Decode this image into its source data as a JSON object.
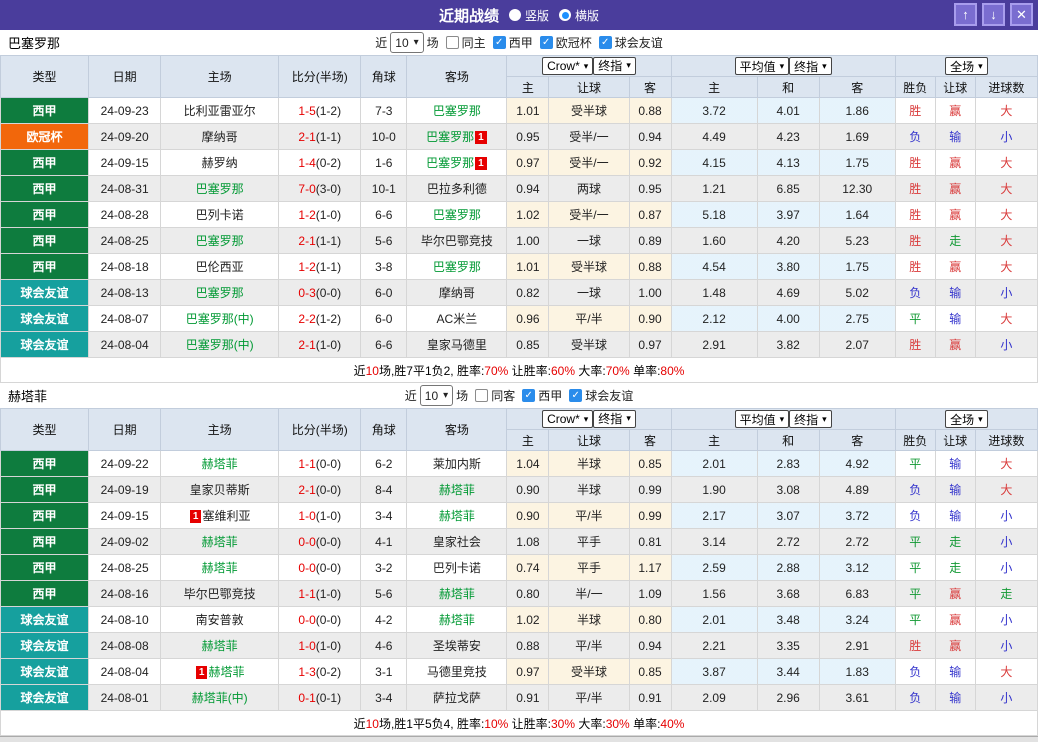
{
  "title_bar": {
    "title": "近期战绩",
    "modes": [
      {
        "label": "竖版",
        "selected": false
      },
      {
        "label": "横版",
        "selected": true
      }
    ]
  },
  "icons": {
    "arrow_up": "↑",
    "arrow_down": "↓",
    "close": "✕",
    "chevron_down": "▾",
    "check": "✓"
  },
  "colors": {
    "titlebar": "#4a3d9c",
    "type": {
      "西甲": "#0e7c3e",
      "欧冠杯": "#f2670b",
      "球会友谊": "#16a09e"
    },
    "team_green": "#009933",
    "score_red": "#e60000",
    "badge_red": "#e60000",
    "checkbox_blue": "#2a8ceb",
    "radio_selected": "#1e90ff",
    "result": {
      "胜": "#d93a3a",
      "赢": "#d93a3a",
      "大": "#d93a3a",
      "平": "#119933",
      "走": "#119933",
      "负": "#3333cc",
      "输": "#3333cc",
      "小": "#3333cc"
    }
  },
  "header": {
    "type": "类型",
    "date": "日期",
    "home": "主场",
    "score": "比分(半场)",
    "corner": "角球",
    "away": "客场",
    "crow": "Crow*",
    "final1": "终指",
    "avg": "平均值",
    "final2": "终指",
    "fulltime": "全场",
    "sub": [
      "主",
      "让球",
      "客",
      "主",
      "和",
      "客",
      "胜负",
      "让球",
      "进球数"
    ]
  },
  "teams": [
    {
      "name": "巴塞罗那",
      "filter": {
        "prefix": "近",
        "count": "10",
        "suffix": "场",
        "same": {
          "label": "同主",
          "checked": false
        },
        "leagues": [
          {
            "label": "西甲",
            "checked": true
          },
          {
            "label": "欧冠杯",
            "checked": true
          },
          {
            "label": "球会友谊",
            "checked": true
          }
        ]
      },
      "rows": [
        {
          "type": "西甲",
          "date": "24-09-23",
          "home": "比利亚雷亚尔",
          "home_green": false,
          "score": "1-5",
          "half": "(1-2)",
          "corner": "7-3",
          "away": "巴塞罗那",
          "away_green": true,
          "odds": [
            "1.01",
            "受半球",
            "0.88"
          ],
          "avg": [
            "3.72",
            "4.01",
            "1.86"
          ],
          "results": [
            "胜",
            "赢",
            "大"
          ]
        },
        {
          "type": "欧冠杯",
          "date": "24-09-20",
          "home": "摩纳哥",
          "home_green": false,
          "score": "2-1",
          "half": "(1-1)",
          "corner": "10-0",
          "away": "巴塞罗那",
          "away_green": true,
          "away_badge": "1",
          "odds": [
            "0.95",
            "受半/一",
            "0.94"
          ],
          "avg": [
            "4.49",
            "4.23",
            "1.69"
          ],
          "results": [
            "负",
            "输",
            "小"
          ]
        },
        {
          "type": "西甲",
          "date": "24-09-15",
          "home": "赫罗纳",
          "home_green": false,
          "score": "1-4",
          "half": "(0-2)",
          "corner": "1-6",
          "away": "巴塞罗那",
          "away_green": true,
          "away_badge": "1",
          "odds": [
            "0.97",
            "受半/一",
            "0.92"
          ],
          "avg": [
            "4.15",
            "4.13",
            "1.75"
          ],
          "results": [
            "胜",
            "赢",
            "大"
          ]
        },
        {
          "type": "西甲",
          "date": "24-08-31",
          "home": "巴塞罗那",
          "home_green": true,
          "score": "7-0",
          "half": "(3-0)",
          "corner": "10-1",
          "away": "巴拉多利德",
          "away_green": false,
          "odds": [
            "0.94",
            "两球",
            "0.95"
          ],
          "avg": [
            "1.21",
            "6.85",
            "12.30"
          ],
          "results": [
            "胜",
            "赢",
            "大"
          ]
        },
        {
          "type": "西甲",
          "date": "24-08-28",
          "home": "巴列卡诺",
          "home_green": false,
          "score": "1-2",
          "half": "(1-0)",
          "corner": "6-6",
          "away": "巴塞罗那",
          "away_green": true,
          "odds": [
            "1.02",
            "受半/一",
            "0.87"
          ],
          "avg": [
            "5.18",
            "3.97",
            "1.64"
          ],
          "results": [
            "胜",
            "赢",
            "大"
          ]
        },
        {
          "type": "西甲",
          "date": "24-08-25",
          "home": "巴塞罗那",
          "home_green": true,
          "score": "2-1",
          "half": "(1-1)",
          "corner": "5-6",
          "away": "毕尔巴鄂竞技",
          "away_green": false,
          "odds": [
            "1.00",
            "一球",
            "0.89"
          ],
          "avg": [
            "1.60",
            "4.20",
            "5.23"
          ],
          "results": [
            "胜",
            "走",
            "大"
          ]
        },
        {
          "type": "西甲",
          "date": "24-08-18",
          "home": "巴伦西亚",
          "home_green": false,
          "score": "1-2",
          "half": "(1-1)",
          "corner": "3-8",
          "away": "巴塞罗那",
          "away_green": true,
          "odds": [
            "1.01",
            "受半球",
            "0.88"
          ],
          "avg": [
            "4.54",
            "3.80",
            "1.75"
          ],
          "results": [
            "胜",
            "赢",
            "大"
          ]
        },
        {
          "type": "球会友谊",
          "date": "24-08-13",
          "home": "巴塞罗那",
          "home_green": true,
          "score": "0-3",
          "half": "(0-0)",
          "corner": "6-0",
          "away": "摩纳哥",
          "away_green": false,
          "odds": [
            "0.82",
            "一球",
            "1.00"
          ],
          "avg": [
            "1.48",
            "4.69",
            "5.02"
          ],
          "results": [
            "负",
            "输",
            "小"
          ]
        },
        {
          "type": "球会友谊",
          "date": "24-08-07",
          "home": "巴塞罗那(中)",
          "home_green": true,
          "score": "2-2",
          "half": "(1-2)",
          "corner": "6-0",
          "away": "AC米兰",
          "away_green": false,
          "odds": [
            "0.96",
            "平/半",
            "0.90"
          ],
          "avg": [
            "2.12",
            "4.00",
            "2.75"
          ],
          "results": [
            "平",
            "输",
            "大"
          ]
        },
        {
          "type": "球会友谊",
          "date": "24-08-04",
          "home": "巴塞罗那(中)",
          "home_green": true,
          "score": "2-1",
          "half": "(1-0)",
          "corner": "6-6",
          "away": "皇家马德里",
          "away_green": false,
          "odds": [
            "0.85",
            "受半球",
            "0.97"
          ],
          "avg": [
            "2.91",
            "3.82",
            "2.07"
          ],
          "results": [
            "胜",
            "赢",
            "小"
          ]
        }
      ],
      "summary_parts": [
        {
          "text": "近"
        },
        {
          "text": "10",
          "red": true
        },
        {
          "text": "场,胜7平1负2, 胜率:"
        },
        {
          "text": "70%",
          "red": true
        },
        {
          "text": " 让胜率:"
        },
        {
          "text": "60%",
          "red": true
        },
        {
          "text": " 大率:"
        },
        {
          "text": "70%",
          "red": true
        },
        {
          "text": " 单率:"
        },
        {
          "text": "80%",
          "red": true
        }
      ]
    },
    {
      "name": "赫塔菲",
      "filter": {
        "prefix": "近",
        "count": "10",
        "suffix": "场",
        "same": {
          "label": "同客",
          "checked": false
        },
        "leagues": [
          {
            "label": "西甲",
            "checked": true
          },
          {
            "label": "球会友谊",
            "checked": true
          }
        ]
      },
      "rows": [
        {
          "type": "西甲",
          "date": "24-09-22",
          "home": "赫塔菲",
          "home_green": true,
          "score": "1-1",
          "half": "(0-0)",
          "corner": "6-2",
          "away": "莱加内斯",
          "away_green": false,
          "odds": [
            "1.04",
            "半球",
            "0.85"
          ],
          "avg": [
            "2.01",
            "2.83",
            "4.92"
          ],
          "results": [
            "平",
            "输",
            "大"
          ]
        },
        {
          "type": "西甲",
          "date": "24-09-19",
          "home": "皇家贝蒂斯",
          "home_green": false,
          "score": "2-1",
          "half": "(0-0)",
          "corner": "8-4",
          "away": "赫塔菲",
          "away_green": true,
          "odds": [
            "0.90",
            "半球",
            "0.99"
          ],
          "avg": [
            "1.90",
            "3.08",
            "4.89"
          ],
          "results": [
            "负",
            "输",
            "大"
          ]
        },
        {
          "type": "西甲",
          "date": "24-09-15",
          "home": "塞维利亚",
          "home_green": false,
          "home_badge": "1",
          "score": "1-0",
          "half": "(1-0)",
          "corner": "3-4",
          "away": "赫塔菲",
          "away_green": true,
          "odds": [
            "0.90",
            "平/半",
            "0.99"
          ],
          "avg": [
            "2.17",
            "3.07",
            "3.72"
          ],
          "results": [
            "负",
            "输",
            "小"
          ]
        },
        {
          "type": "西甲",
          "date": "24-09-02",
          "home": "赫塔菲",
          "home_green": true,
          "score": "0-0",
          "half": "(0-0)",
          "corner": "4-1",
          "away": "皇家社会",
          "away_green": false,
          "odds": [
            "1.08",
            "平手",
            "0.81"
          ],
          "avg": [
            "3.14",
            "2.72",
            "2.72"
          ],
          "results": [
            "平",
            "走",
            "小"
          ]
        },
        {
          "type": "西甲",
          "date": "24-08-25",
          "home": "赫塔菲",
          "home_green": true,
          "score": "0-0",
          "half": "(0-0)",
          "corner": "3-2",
          "away": "巴列卡诺",
          "away_green": false,
          "odds": [
            "0.74",
            "平手",
            "1.17"
          ],
          "avg": [
            "2.59",
            "2.88",
            "3.12"
          ],
          "results": [
            "平",
            "走",
            "小"
          ]
        },
        {
          "type": "西甲",
          "date": "24-08-16",
          "home": "毕尔巴鄂竞技",
          "home_green": false,
          "score": "1-1",
          "half": "(1-0)",
          "corner": "5-6",
          "away": "赫塔菲",
          "away_green": true,
          "odds": [
            "0.80",
            "半/一",
            "1.09"
          ],
          "avg": [
            "1.56",
            "3.68",
            "6.83"
          ],
          "results": [
            "平",
            "赢",
            "走"
          ]
        },
        {
          "type": "球会友谊",
          "date": "24-08-10",
          "home": "南安普敦",
          "home_green": false,
          "score": "0-0",
          "half": "(0-0)",
          "corner": "4-2",
          "away": "赫塔菲",
          "away_green": true,
          "odds": [
            "1.02",
            "半球",
            "0.80"
          ],
          "avg": [
            "2.01",
            "3.48",
            "3.24"
          ],
          "results": [
            "平",
            "赢",
            "小"
          ]
        },
        {
          "type": "球会友谊",
          "date": "24-08-08",
          "home": "赫塔菲",
          "home_green": true,
          "score": "1-0",
          "half": "(1-0)",
          "corner": "4-6",
          "away": "圣埃蒂安",
          "away_green": false,
          "odds": [
            "0.88",
            "平/半",
            "0.94"
          ],
          "avg": [
            "2.21",
            "3.35",
            "2.91"
          ],
          "results": [
            "胜",
            "赢",
            "小"
          ]
        },
        {
          "type": "球会友谊",
          "date": "24-08-04",
          "home": "赫塔菲",
          "home_green": true,
          "home_badge": "1",
          "score": "1-3",
          "half": "(0-2)",
          "corner": "3-1",
          "away": "马德里竞技",
          "away_green": false,
          "odds": [
            "0.97",
            "受半球",
            "0.85"
          ],
          "avg": [
            "3.87",
            "3.44",
            "1.83"
          ],
          "results": [
            "负",
            "输",
            "大"
          ]
        },
        {
          "type": "球会友谊",
          "date": "24-08-01",
          "home": "赫塔菲(中)",
          "home_green": true,
          "score": "0-1",
          "half": "(0-1)",
          "corner": "3-4",
          "away": "萨拉戈萨",
          "away_green": false,
          "odds": [
            "0.91",
            "平/半",
            "0.91"
          ],
          "avg": [
            "2.09",
            "2.96",
            "3.61"
          ],
          "results": [
            "负",
            "输",
            "小"
          ]
        }
      ],
      "summary_parts": [
        {
          "text": "近"
        },
        {
          "text": "10",
          "red": true
        },
        {
          "text": "场,胜1平5负4, 胜率:"
        },
        {
          "text": "10%",
          "red": true
        },
        {
          "text": " 让胜率:"
        },
        {
          "text": "30%",
          "red": true
        },
        {
          "text": " 大率:"
        },
        {
          "text": "30%",
          "red": true
        },
        {
          "text": " 单率:"
        },
        {
          "text": "40%",
          "red": true
        }
      ]
    }
  ]
}
